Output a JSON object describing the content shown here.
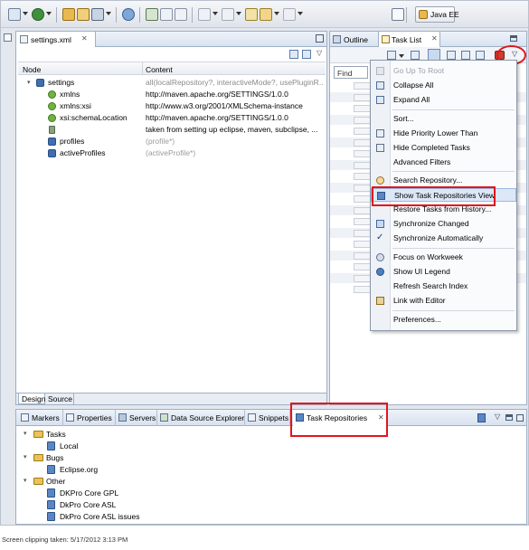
{
  "toolbar": {
    "perspective_label": "Java EE"
  },
  "editor": {
    "tab_label": "settings.xml",
    "close_glyph": "✕",
    "columns": {
      "node": "Node",
      "content": "Content"
    },
    "rows": [
      {
        "label": "settings",
        "content": "all(localRepository?, interactiveMode?, usePluginR...",
        "icon": "element-icon",
        "indent": 0,
        "expanded": true,
        "content_style": "grey"
      },
      {
        "label": "xmlns",
        "content": "http://maven.apache.org/SETTINGS/1.0.0",
        "icon": "attribute-icon",
        "indent": 1
      },
      {
        "label": "xmlns:xsi",
        "content": "http://www.w3.org/2001/XMLSchema-instance",
        "icon": "attribute-icon",
        "indent": 1
      },
      {
        "label": "xsi:schemaLocation",
        "content": "http://maven.apache.org/SETTINGS/1.0.0",
        "icon": "attribute-icon",
        "indent": 1
      },
      {
        "label": "",
        "content": " taken from setting up eclipse, maven, subclipse, ...",
        "icon": "comment-icon",
        "indent": 1
      },
      {
        "label": "profiles",
        "content": "(profile*)",
        "icon": "element-icon",
        "indent": 1,
        "content_style": "grey"
      },
      {
        "label": "activeProfiles",
        "content": "(activeProfile*)",
        "icon": "element-icon",
        "indent": 1,
        "content_style": "grey"
      }
    ],
    "bottom_tabs": {
      "design": "Design",
      "source": "Source"
    }
  },
  "right_panel": {
    "tab_outline": "Outline",
    "tab_tasklist": "Task List",
    "close_glyph": "✕",
    "find_label": "Find"
  },
  "menu": {
    "items": [
      {
        "label": "Go Up To Root",
        "disabled": true,
        "icon": "go-up-icon"
      },
      {
        "label": "Collapse All",
        "icon": "collapse-all-icon"
      },
      {
        "label": "Expand All",
        "icon": "expand-all-icon"
      },
      {
        "label": "Sort...",
        "icon": ""
      },
      {
        "label": "Hide Priority Lower Than",
        "icon": "hide-priority-icon"
      },
      {
        "label": "Hide Completed Tasks",
        "icon": "hide-completed-icon"
      },
      {
        "label": "Advanced Filters",
        "icon": ""
      },
      {
        "label": "Search Repository...",
        "icon": "search-repository-icon"
      },
      {
        "label": "Show Task Repositories View",
        "icon": "task-repositories-icon",
        "highlight": true
      },
      {
        "label": "Restore Tasks from History...",
        "icon": ""
      },
      {
        "label": "Synchronize Changed",
        "icon": "synchronize-icon"
      },
      {
        "label": "Synchronize Automatically",
        "icon": "checkmark-icon",
        "checked": true
      },
      {
        "label": "Focus on Workweek",
        "icon": "focus-icon"
      },
      {
        "label": "Show UI Legend",
        "icon": "legend-icon"
      },
      {
        "label": "Refresh Search Index",
        "icon": ""
      },
      {
        "label": "Link with Editor",
        "icon": "link-icon"
      },
      {
        "label": "Preferences...",
        "icon": ""
      }
    ]
  },
  "bottom_view": {
    "tabs": [
      {
        "label": "Markers",
        "icon": "markers-icon"
      },
      {
        "label": "Properties",
        "icon": "properties-icon"
      },
      {
        "label": "Servers",
        "icon": "servers-icon"
      },
      {
        "label": "Data Source Explorer",
        "icon": "data-source-icon"
      },
      {
        "label": "Snippets",
        "icon": "snippets-icon"
      },
      {
        "label": "Task Repositories",
        "icon": "task-repositories-icon"
      }
    ],
    "close_glyph": "✕",
    "tree": [
      {
        "label": "Tasks",
        "type": "folder",
        "indent": 0
      },
      {
        "label": "Local",
        "type": "repo",
        "indent": 1
      },
      {
        "label": "Bugs",
        "type": "folder",
        "indent": 0
      },
      {
        "label": "Eclipse.org",
        "type": "repo",
        "indent": 1
      },
      {
        "label": "Other",
        "type": "folder",
        "indent": 0
      },
      {
        "label": "DKPro Core GPL",
        "type": "repo",
        "indent": 1
      },
      {
        "label": "DkPro Core ASL",
        "type": "repo",
        "indent": 1
      },
      {
        "label": "DkPro Core ASL issues",
        "type": "repo",
        "indent": 1
      }
    ]
  },
  "footer": {
    "text": "Screen clipping taken: 5/17/2012 3:13 PM"
  },
  "colors": {
    "highlight_red": "#e0161d",
    "panel_border": "#9fb0c6",
    "menu_highlight": "#dce8f7"
  }
}
